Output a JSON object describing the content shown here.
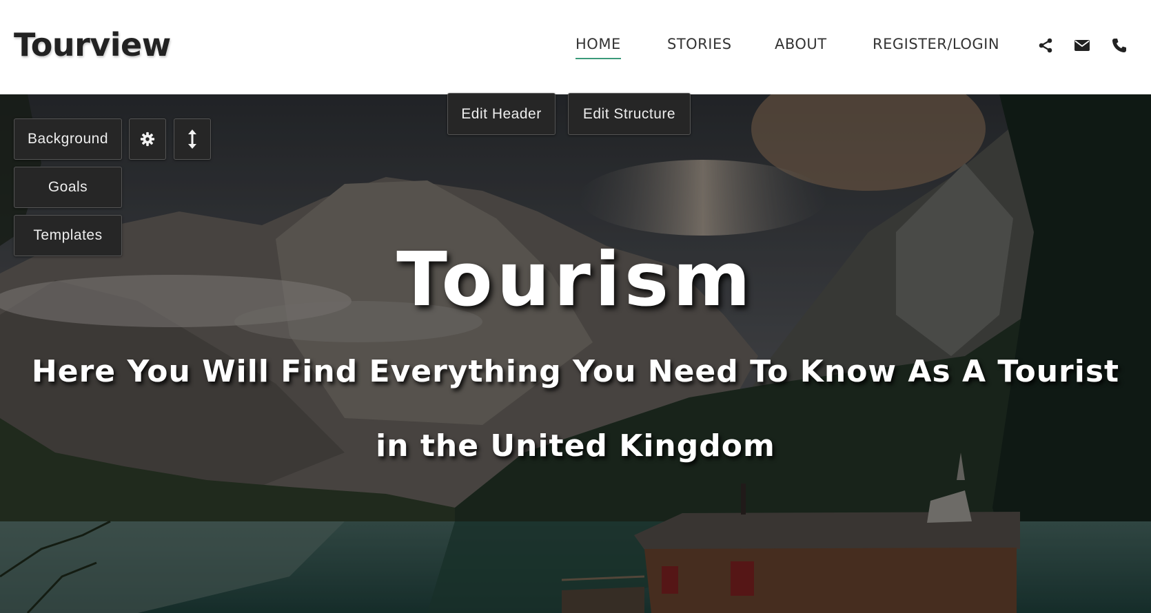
{
  "header": {
    "logo": "Tourview",
    "nav": [
      {
        "label": "HOME",
        "active": true
      },
      {
        "label": "STORIES",
        "active": false
      },
      {
        "label": "ABOUT",
        "active": false
      },
      {
        "label": "REGISTER/LOGIN",
        "active": false
      }
    ],
    "icons": [
      "share-icon",
      "mail-icon",
      "phone-icon"
    ],
    "accent_color": "#3a9a7a"
  },
  "editor": {
    "edit_header": "Edit Header",
    "edit_structure": "Edit Structure",
    "background": "Background",
    "settings_icon": "gear-icon",
    "resize_icon": "vertical-resize-icon",
    "goals": "Goals",
    "templates": "Templates"
  },
  "hero": {
    "title": "Tourism",
    "subtitle_line1": "Here You Will Find Everything You Need To Know As A Tourist",
    "subtitle_line2": "in the United Kingdom",
    "background_image": "mountain-lake-cabin-photo"
  }
}
